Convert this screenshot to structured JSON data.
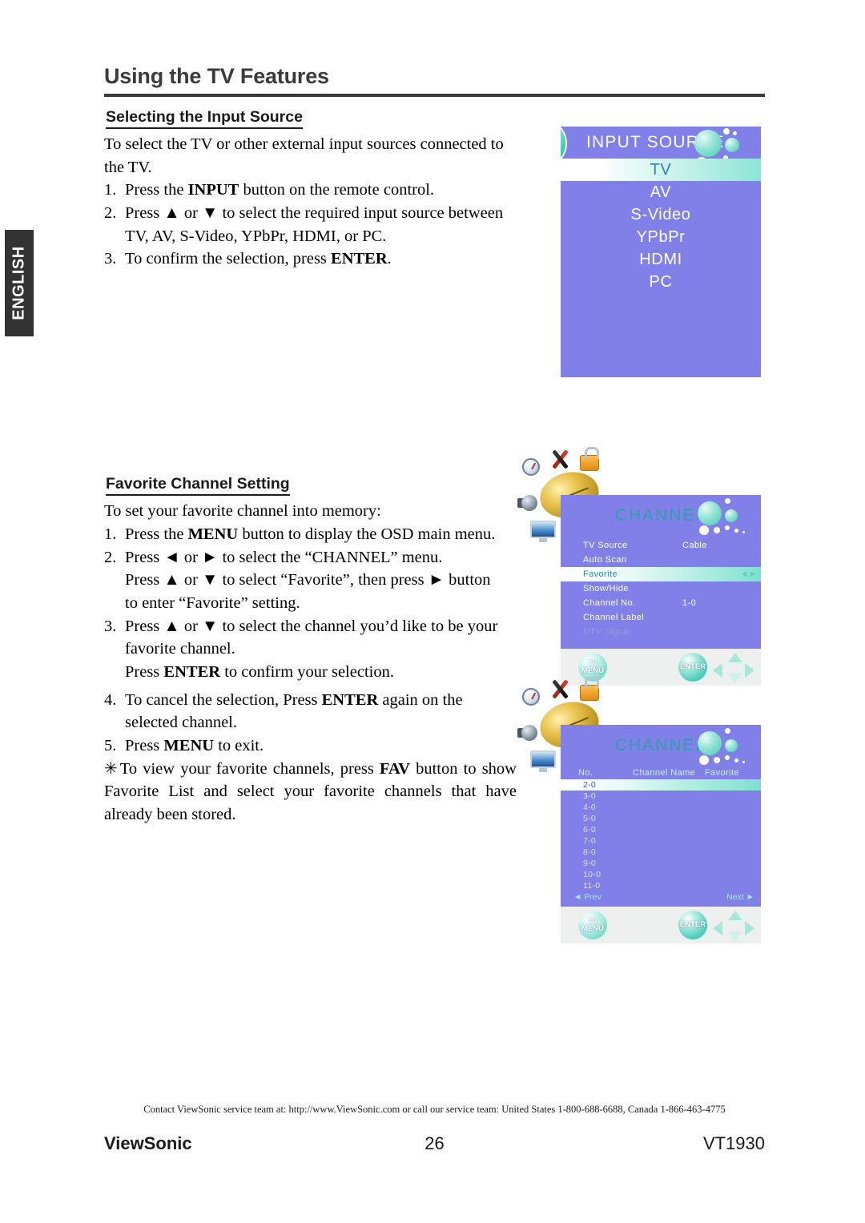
{
  "language_tab": "ENGLISH",
  "page_title": "Using the TV Features",
  "sections": {
    "input_source": {
      "heading": "Selecting the Input Source",
      "lead": "To select the TV or other external input sources connected to the TV.",
      "steps": [
        {
          "num": "1.",
          "text_pre": "Press the ",
          "bold": "INPUT",
          "text_post": " button on the remote control."
        },
        {
          "num": "2.",
          "text_pre": "Press ▲ or ▼ to select the required input source between TV, AV, S-Video, YPbPr, HDMI, or PC."
        },
        {
          "num": "3.",
          "text_pre": "To confirm the selection, press ",
          "bold": "ENTER",
          "text_post": "."
        }
      ]
    },
    "favorite_channel": {
      "heading": "Favorite Channel Setting",
      "lead": "To set your favorite channel into memory:",
      "step1": {
        "num": "1.",
        "pre": "Press the ",
        "bold": "MENU",
        "post": " button to display the OSD main menu."
      },
      "step2": {
        "num": "2.",
        "line1": "Press ◄ or ► to select the “CHANNEL” menu.",
        "line2": "Press ▲ or ▼ to select “Favorite”, then press ► button",
        "line3": "to enter “Favorite” setting."
      },
      "step3": {
        "num": "3.",
        "line1": "Press ▲ or ▼ to select the channel you’d like to be your",
        "line2": "favorite channel.",
        "line3_pre": "Press ",
        "line3_bold": "ENTER",
        "line3_post": " to confirm your selection."
      },
      "step4": {
        "num": "4.",
        "pre": "To cancel the selection, Press ",
        "bold": "ENTER",
        "post": " again on the selected channel."
      },
      "step5": {
        "num": "5.",
        "pre": "Press ",
        "bold": "MENU",
        "post": " to exit."
      },
      "note": {
        "star": "✳",
        "pre": "To view your favorite channels, press ",
        "bold": "FAV",
        "post": " button to show Favorite List and select your favorite channels that have already been stored."
      }
    }
  },
  "osd": {
    "input_source": {
      "title": "INPUT SOURCE",
      "badge_icon": "face-badge-icon",
      "items": [
        {
          "label": "TV",
          "selected": true
        },
        {
          "label": "AV",
          "selected": false
        },
        {
          "label": "S-Video",
          "selected": false
        },
        {
          "label": "YPbPr",
          "selected": false
        },
        {
          "label": "HDMI",
          "selected": false
        },
        {
          "label": "PC",
          "selected": false
        }
      ]
    },
    "channel_menu": {
      "title": "CHANNEL",
      "rows": [
        {
          "label": "TV Source",
          "value": "Cable",
          "state": "normal"
        },
        {
          "label": "Auto Scan",
          "value": "",
          "state": "normal"
        },
        {
          "label": "Favorite",
          "value": "",
          "state": "highlight",
          "arrow": "◄►"
        },
        {
          "label": "Show/Hide",
          "value": "",
          "state": "normal"
        },
        {
          "label": "Channel No.",
          "value": "1-0",
          "state": "normal"
        },
        {
          "label": "Channel Label",
          "value": "",
          "state": "normal"
        },
        {
          "label": "DTV Signal",
          "value": "",
          "state": "dim"
        }
      ]
    },
    "channel_list": {
      "title": "CHANNEL",
      "columns": {
        "no": "No.",
        "name": "Channel Name",
        "favorite": "Favorite"
      },
      "rows": [
        {
          "no": "2-0",
          "name": "",
          "favorite": "",
          "selected": true
        },
        {
          "no": "3-0",
          "name": "",
          "favorite": "",
          "selected": false
        },
        {
          "no": "4-0",
          "name": "",
          "favorite": "",
          "selected": false
        },
        {
          "no": "5-0",
          "name": "",
          "favorite": "",
          "selected": false
        },
        {
          "no": "6-0",
          "name": "",
          "favorite": "",
          "selected": false
        },
        {
          "no": "7-0",
          "name": "",
          "favorite": "",
          "selected": false
        },
        {
          "no": "8-0",
          "name": "",
          "favorite": "",
          "selected": false
        },
        {
          "no": "9-0",
          "name": "",
          "favorite": "",
          "selected": false
        },
        {
          "no": "10-0",
          "name": "",
          "favorite": "",
          "selected": false
        },
        {
          "no": "11-0",
          "name": "",
          "favorite": "",
          "selected": false
        }
      ],
      "prev": "◄ Prev",
      "next": "Next ►"
    },
    "footer_buttons": {
      "menu_line1": "TV",
      "menu_line2": "MENU",
      "enter": "ENTER"
    },
    "colors": {
      "panel_purple": "#8080e8",
      "highlight_teal": "#7fe0d0",
      "title_teal": "#2f9ea8",
      "footer_bar": "#eef0f0"
    }
  },
  "footer": {
    "contact": "Contact ViewSonic service team at: http://www.ViewSonic.com or call our service team: United States 1-800-688-6688, Canada 1-866-463-4775",
    "brand": "ViewSonic",
    "page_number": "26",
    "model": "VT1930"
  }
}
